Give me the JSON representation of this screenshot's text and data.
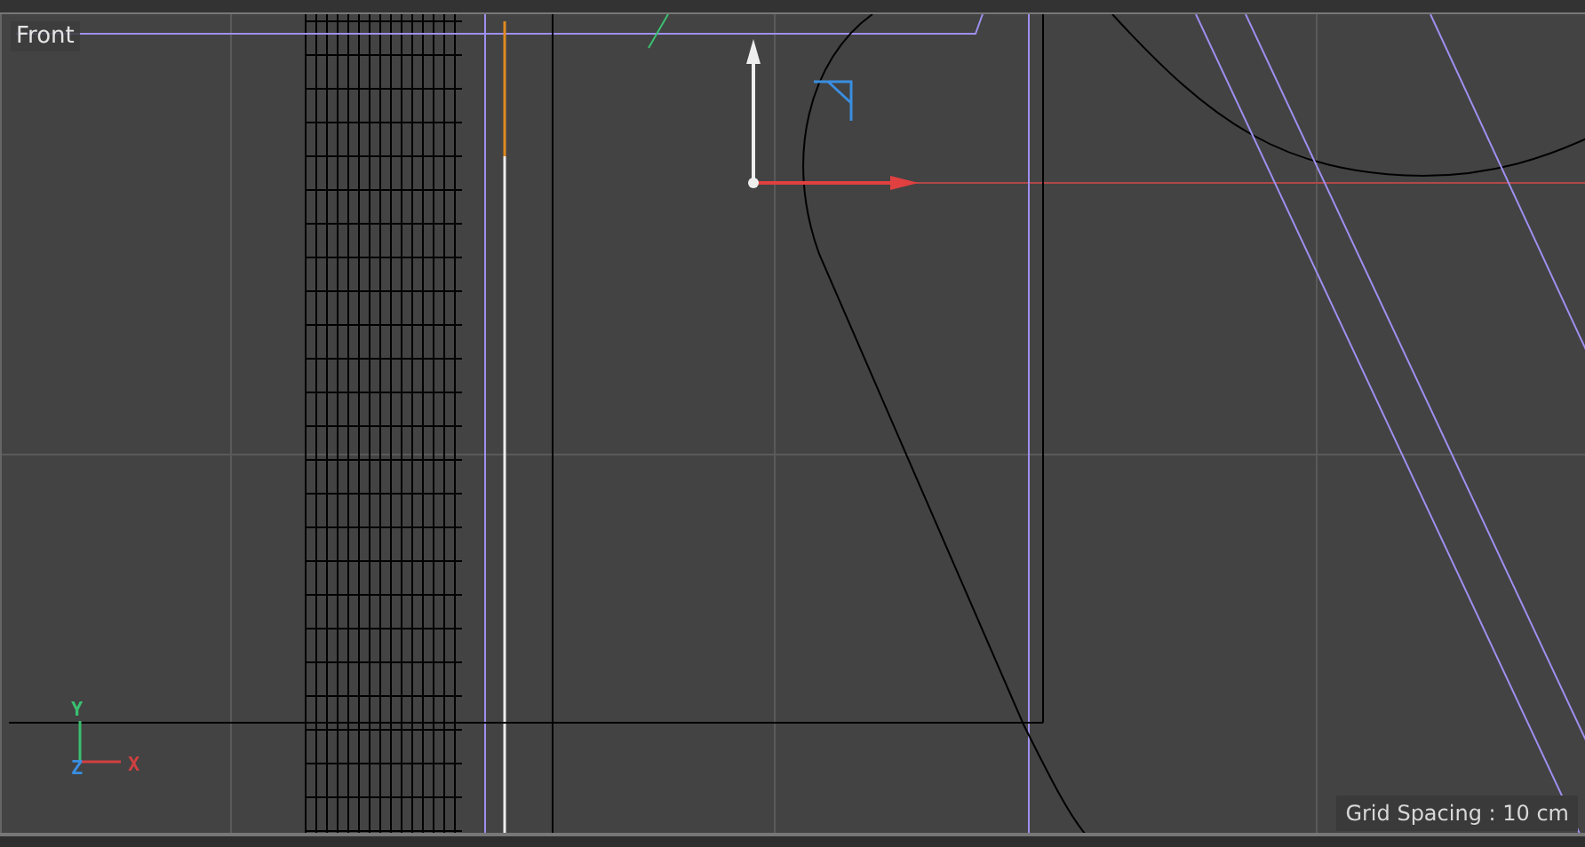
{
  "viewport": {
    "title": "Front",
    "axis_labels": [
      "Y",
      "Z",
      "X"
    ],
    "status": "Grid Spacing : 10 cm"
  }
}
